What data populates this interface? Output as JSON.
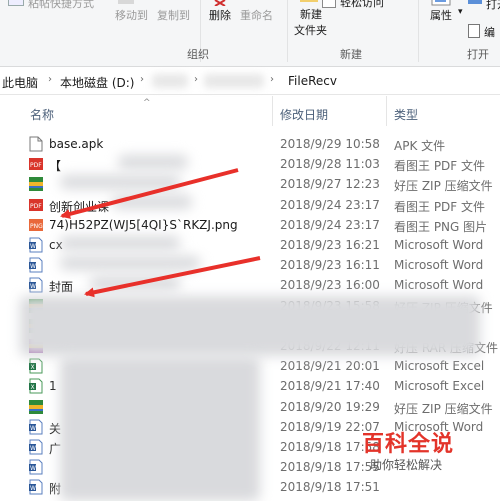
{
  "ribbon": {
    "top_left_fragment": "粘帖快捷方式",
    "move_to": "移动到",
    "copy_to": "复制到",
    "delete": "删除",
    "rename": "重命名",
    "new_folder_line1": "新建",
    "new_folder_line2": "文件夹",
    "easy_access": "轻松访问",
    "properties": "属性",
    "open": "打开",
    "edit": "编",
    "group_organize": "组织",
    "group_new": "新建",
    "group_open": "打开"
  },
  "address": {
    "crumbs": [
      "此电脑",
      "本地磁盘 (D:)",
      "FileRecv"
    ]
  },
  "columns": {
    "name": "名称",
    "modified": "修改日期",
    "type": "类型"
  },
  "files": [
    {
      "name": "base.apk",
      "date": "2018/9/29 10:58",
      "type": "APK 文件",
      "icon": "generic-file-icon"
    },
    {
      "name": "【",
      "date": "2018/9/28 11:03",
      "type": "看图王 PDF 文件",
      "icon": "pdf-icon"
    },
    {
      "name": "",
      "date": "2018/9/27 12:23",
      "type": "好压 ZIP 压缩文件",
      "icon": "zip-icon"
    },
    {
      "name": "创新创业课",
      "date": "2018/9/24 23:17",
      "type": "看图王 PDF 文件",
      "icon": "pdf-icon"
    },
    {
      "name": "74)H52PZ(WJ5[4QI}S`RKZJ.png",
      "date": "2018/9/24 23:17",
      "type": "看图王 PNG 图片",
      "icon": "png-icon"
    },
    {
      "name": "cx",
      "date": "2018/9/23 16:21",
      "type": "Microsoft Word",
      "icon": "word-icon"
    },
    {
      "name": "",
      "date": "2018/9/23 16:11",
      "type": "Microsoft Word",
      "icon": "word-icon"
    },
    {
      "name": "封面",
      "date": "2018/9/23 16:00",
      "type": "Microsoft Word",
      "icon": "word-icon"
    },
    {
      "name": "",
      "date": "2018/9/23 15:58",
      "type": "好压 ZIP 压缩文件",
      "icon": "zip-icon"
    },
    {
      "name": "",
      "date": "",
      "type": "",
      "icon": "zip-icon"
    },
    {
      "name": "",
      "date": "2018/9/22 12:11",
      "type": "好压 RAR 压缩文件",
      "icon": "rar-icon"
    },
    {
      "name": "",
      "date": "2018/9/21 20:01",
      "type": "Microsoft Excel",
      "icon": "excel-icon"
    },
    {
      "name": "1",
      "date": "2018/9/21 17:40",
      "type": "Microsoft Excel",
      "icon": "excel-icon"
    },
    {
      "name": "",
      "date": "2018/9/20 19:29",
      "type": "好压 ZIP 压缩文件",
      "icon": "zip-icon"
    },
    {
      "name": "关",
      "date": "2018/9/19 22:07",
      "type": "Microsoft Word",
      "icon": "word-icon"
    },
    {
      "name": "广",
      "date": "2018/9/18 17:58",
      "type": "",
      "icon": "word-icon"
    },
    {
      "name": "",
      "date": "2018/9/18 17:55",
      "type": "",
      "icon": "word-icon"
    },
    {
      "name": "附",
      "date": "2018/9/18 17:51",
      "type": "",
      "icon": "word-icon"
    }
  ],
  "watermark": {
    "title": "百科全说",
    "subtitle": "助你轻松解决"
  }
}
